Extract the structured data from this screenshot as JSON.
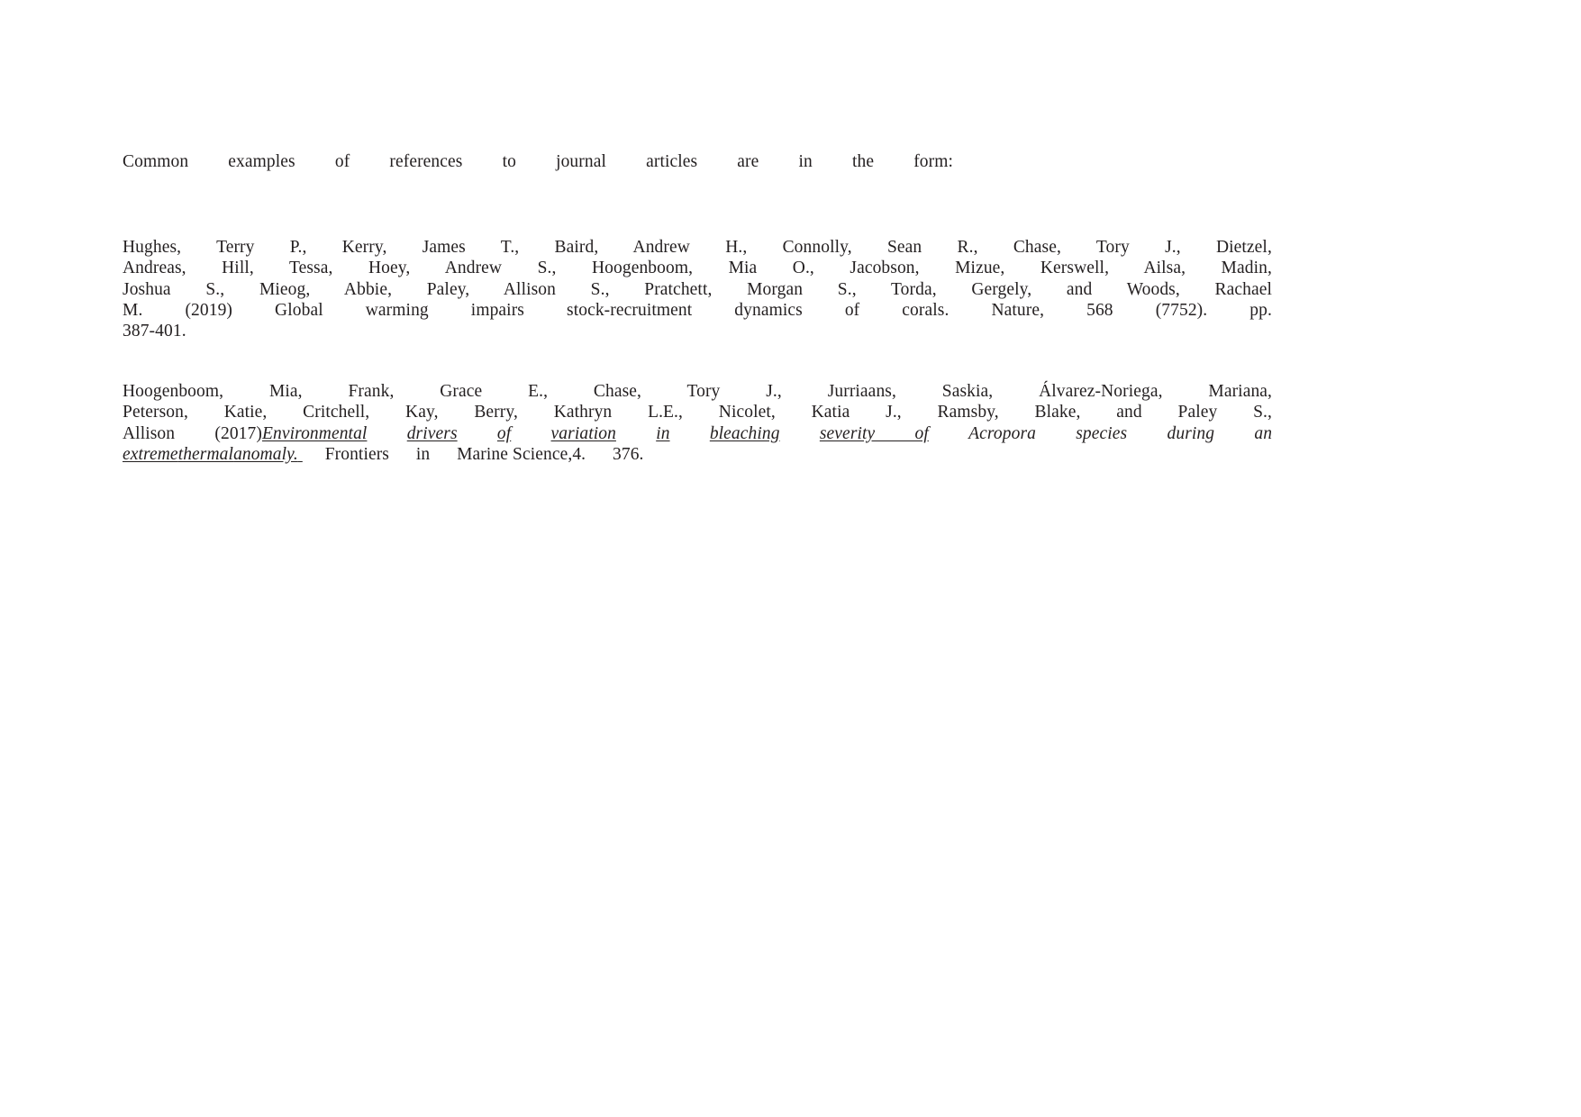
{
  "document": {
    "background_color": "#ffffff",
    "text_color": "#231f20",
    "intro": {
      "text": "Common examples of references to journal articles are in the form:"
    },
    "references": [
      {
        "id": "hughes-2019",
        "authors": "Hughes, Terry P., Kerry, James T., Baird, Andrew H., Connolly, Sean R., Chase, Tory J., Dietzel, Andreas, Hill, Tessa, Hoey, Andrew S., Hoogenboom, Mia O., Jacobson, Mizue, Kerswell, Ailsa, Madin, Joshua S., Mieog, Abbie, Paley, Allison S., Pratchett, Morgan S., Torda, Gergely, and Woods, Rachael M.",
        "year": "(2019)",
        "title": "Global warming impairs stock-recruitment dynamics of corals.",
        "journal": "Nature,",
        "volume": "568",
        "issue": "(7752).",
        "pages_label": "pp.",
        "pages": "387-401.",
        "title_style": "plain",
        "lines": [
          "Hughes, Terry P., Kerry, James T., Baird, Andrew H., Connolly, Sean R., Chase, Tory J., Dietzel,",
          "Andreas, Hill, Tessa, Hoey, Andrew S., Hoogenboom, Mia O., Jacobson, Mizue, Kerswell, Ailsa, Madin,",
          "Joshua S., Mieog, Abbie, Paley, Allison S., Pratchett, Morgan S., Torda, Gergely, and Woods, Rachael",
          "M. (2019) Global warming impairs stock-recruitment dynamics of corals. Nature, 568 (7752). pp.",
          "387-401."
        ]
      },
      {
        "id": "hoogenboom-2017",
        "authors": "Hoogenboom, Mia, Frank, Grace E., Chase, Tory J., Jurriaans, Saskia, Alvarez-Noriega, Mariana, Peterson, Katie, Critchell, Kay, Berry, Kathryn L.E., Nicolet, Katia J., Ramsby, Blake, and Paley, Allison S.",
        "year": "(2017)",
        "title": "Environmental drivers of variation in bleaching severity of Acropora species during an extreme thermal anomaly.",
        "journal": "Frontiers in Marine Science,",
        "volume": "4.",
        "article_number": "376.",
        "title_style": "italic-underline",
        "lines": [
          "Hoogenboom, Mia, Frank, Grace E., Chase, Tory J., Jurriaans, Saskia, Álvarez-Noriega, Mariana,",
          "Peterson, Katie, Critchell, Kay, Berry, Kathryn L.E., Nicolet, Katia J., Ramsby, Blake, and Paley, S.,",
          "Allison (2017) Environmental drivers of variation in bleaching severity of Acropora species during an",
          "extreme thermal anomaly. Frontiers in Marine Science, 4. 376."
        ],
        "line1_words": [
          "Hoogenboom,",
          "Mia,",
          "Frank,",
          "Grace",
          "E.,",
          "Chase,",
          "Tory",
          "J.,",
          "Jurriaans,",
          "Saskia,",
          "Álvarez-Noriega,",
          "Mariana,"
        ],
        "line2_words": [
          "Peterson,",
          "Katie,",
          "Critchell,",
          "Kay,",
          "Berry,",
          "Kathryn",
          "L.E.,",
          "Nicolet,",
          "Katia",
          "J.,",
          "Ramsby,",
          "Blake,",
          "and",
          "Paley",
          "S.,"
        ],
        "line3_plain_prefix": "Allison (2017)",
        "line3_italic": "Environmental drivers of variation in bleaching severity of Acropora species during an",
        "line4_italic": "extreme thermal anomaly. ",
        "line4_plain": "Frontiers in Marine Science, 4. 376."
      }
    ],
    "line_fragments": {
      "p1": {
        "l1": [
          "Hughes,",
          "Terry",
          "P.,",
          "Kerry,",
          "James",
          "T.,",
          "Baird,",
          "Andrew",
          "H.,",
          "Connolly,",
          "Sean",
          "R.,",
          "Chase,",
          "Tory",
          "J.,",
          "Dietzel,"
        ],
        "l2": [
          "Andreas,",
          "Hill,",
          "Tessa,",
          "Hoey,",
          "Andrew",
          "S.,",
          "Hoogenboom,",
          "Mia",
          "O.,",
          "Jacobson,",
          "Mizue,",
          "Kerswell,",
          "Ailsa,",
          "Madin,"
        ],
        "l3": [
          "Joshua",
          "S.,",
          "Mieog,",
          "Abbie,",
          "Paley,",
          "Allison",
          "S.,",
          "Pratchett,",
          "Morgan",
          "S.,",
          "Torda,",
          "Gergely,",
          "and",
          "Woods,",
          "Rachael"
        ],
        "l4": [
          "M.",
          "(2019)",
          "Global",
          "warming",
          "impairs",
          "stock-recruitment",
          "dynamics",
          "of",
          "corals.",
          "Nature,",
          "568",
          "(7752).",
          "pp."
        ],
        "l5": [
          "387-401."
        ]
      },
      "p2": {
        "l1": [
          "Hoogenboom,",
          "Mia,",
          "Frank,",
          "Grace",
          "E.,",
          "Chase,",
          "Tory",
          "J.,",
          "Jurriaans,",
          "Saskia,",
          "Álvarez-Noriega,",
          "Mariana,"
        ],
        "l2": [
          "Peterson,",
          "Katie,",
          "Critchell,",
          "Kay,",
          "Berry,",
          "Kathryn",
          "L.E.,",
          "Nicolet,",
          "Katia",
          "J.,",
          "Ramsby,",
          "Blake,",
          "and",
          "Paley",
          "S.,"
        ],
        "l3": [
          "Allison",
          "(2017)",
          "Environmental",
          "drivers",
          "of",
          "variation",
          "in",
          "bleaching",
          "severity of",
          "Acropora",
          "species",
          "during",
          "an"
        ],
        "l4": [
          "extreme",
          "thermal",
          "anomaly.",
          "Frontiers",
          "in",
          "Marine",
          "Science,",
          "4.",
          "376."
        ]
      }
    },
    "intro_words": [
      "Common",
      "examples",
      "of",
      "references",
      "to",
      "journal",
      "articles",
      "are",
      "in",
      "the",
      "form:"
    ]
  }
}
